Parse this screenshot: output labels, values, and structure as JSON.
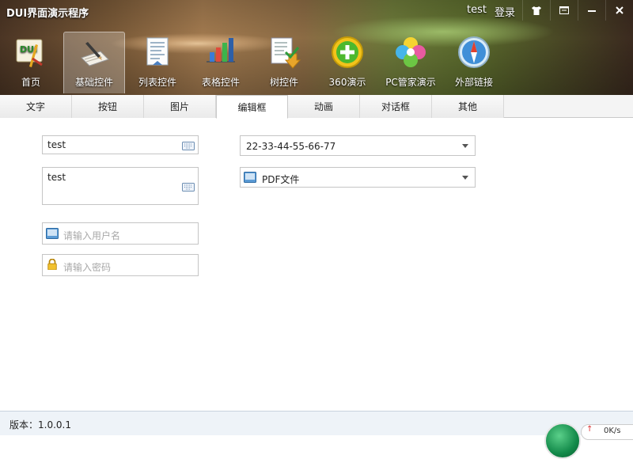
{
  "window": {
    "title": "DUI界面演示程序",
    "user": "test",
    "login": "登录"
  },
  "toolbar": [
    {
      "label": "首页",
      "icon": "dui-logo-icon"
    },
    {
      "label": "基础控件",
      "icon": "pen-paper-icon",
      "active": true
    },
    {
      "label": "列表控件",
      "icon": "document-list-icon"
    },
    {
      "label": "表格控件",
      "icon": "bar-chart-icon"
    },
    {
      "label": "树控件",
      "icon": "tree-document-icon"
    },
    {
      "label": "360演示",
      "icon": "plus-circle-icon"
    },
    {
      "label": "PC管家演示",
      "icon": "clover-icon"
    },
    {
      "label": "外部链接",
      "icon": "compass-icon"
    }
  ],
  "tabs": [
    {
      "label": "文字"
    },
    {
      "label": "按钮"
    },
    {
      "label": "图片"
    },
    {
      "label": "编辑框",
      "active": true
    },
    {
      "label": "动画"
    },
    {
      "label": "对话框"
    },
    {
      "label": "其他"
    }
  ],
  "form": {
    "edit_single": "test",
    "edit_multi": "test",
    "username_placeholder": "请输入用户名",
    "password_placeholder": "请输入密码",
    "combo_mac": "22-33-44-55-66-77",
    "combo_file": "PDF文件"
  },
  "status": {
    "version": "版本：1.0.0.1",
    "speed": "0K/s"
  },
  "colors": {
    "tab_border": "#c9c9c9",
    "status_bg": "#eef3f8",
    "speed_ball": "#138a4a"
  }
}
